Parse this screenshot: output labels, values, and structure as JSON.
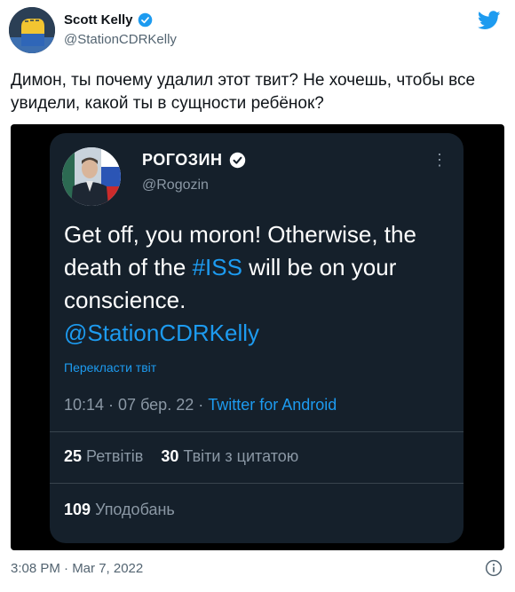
{
  "author": {
    "name": "Scott Kelly",
    "handle": "@StationCDRKelly"
  },
  "tweet": {
    "text": "Димон, ты почему удалил этот твит? Не хочешь, чтобы все увидели, какой ты в сущности ребёнок?",
    "timestamp": "3:08 PM · Mar 7, 2022"
  },
  "embedded": {
    "name": "РОГОЗИН",
    "handle": "@Rogozin",
    "text_before": "Get off, you moron!  Otherwise, the death of the ",
    "hashtag": "#ISS",
    "text_after": " will be on your conscience.",
    "mention": "@StationCDRKelly",
    "translate_label": "Перекласти твіт",
    "time": "10:14 · 07 бер. 22 · ",
    "app": "Twitter for Android",
    "retweets_count": "25",
    "retweets_label": "Ретвітів",
    "quotes_count": "30",
    "quotes_label": "Твіти з цитатою",
    "likes_count": "109",
    "likes_label": "Уподобань"
  },
  "colors": {
    "accent": "#1d9bf0",
    "card_bg": "#15202b",
    "verified": "#1d9bf0"
  },
  "icons": [
    "avatar-image",
    "verified-icon",
    "twitter-bird-icon",
    "more-icon",
    "info-icon"
  ]
}
